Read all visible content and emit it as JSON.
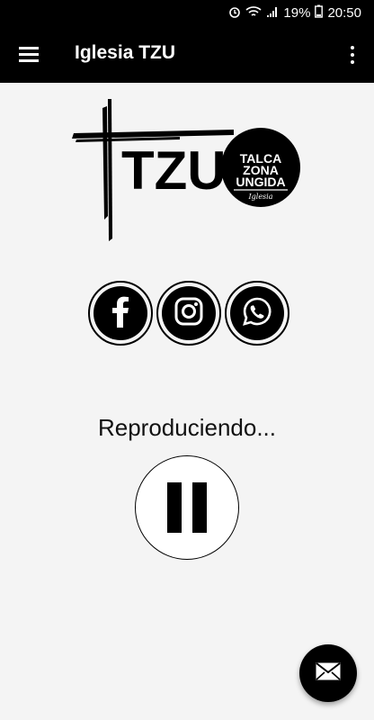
{
  "status": {
    "battery": "19%",
    "time": "20:50"
  },
  "appbar": {
    "title": "Iglesia TZU"
  },
  "logo": {
    "wordmark": "TZU",
    "badge_lines": [
      "TALCA",
      "ZONA",
      "UNGIDA"
    ],
    "badge_script": "Iglesia"
  },
  "socials": [
    "facebook-icon",
    "instagram-icon",
    "whatsapp-icon"
  ],
  "player": {
    "status_text": "Reproduciendo..."
  },
  "colors": {
    "bar": "#000000",
    "background": "#f4f4f4"
  }
}
